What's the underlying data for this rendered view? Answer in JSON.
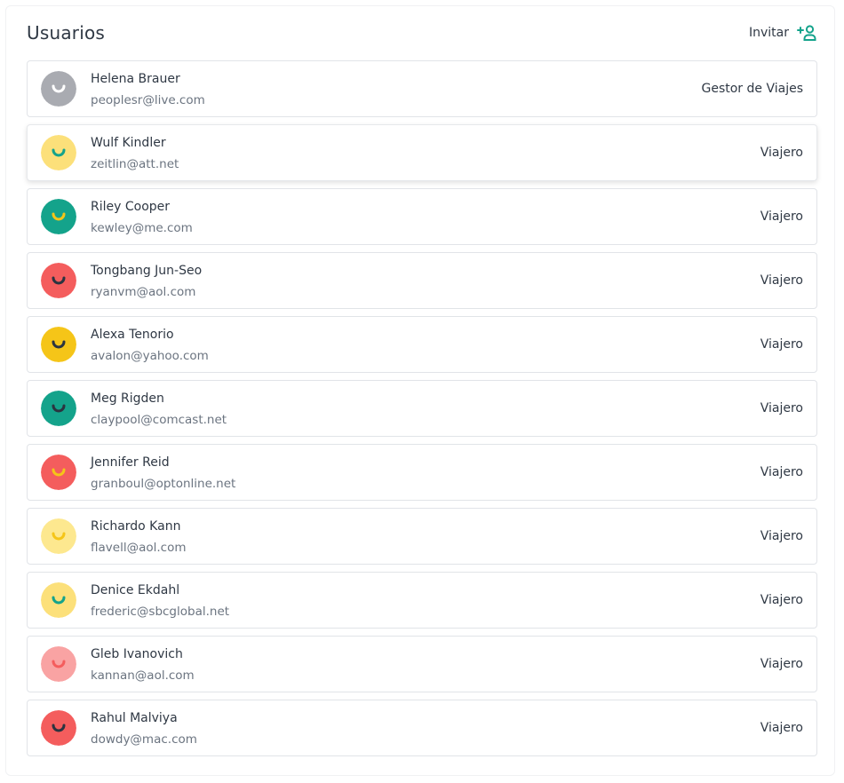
{
  "header": {
    "title": "Usuarios",
    "invite_label": "Invitar",
    "invite_icon": "add-user-icon",
    "invite_color": "#14a38b"
  },
  "users": [
    {
      "name": "Helena Brauer",
      "email": "peoplesr@live.com",
      "role": "Gestor de Viajes",
      "avatar_bg": "#a9abb1",
      "smile_color": "#ffffff"
    },
    {
      "name": "Wulf Kindler",
      "email": "zeitlin@att.net",
      "role": "Viajero",
      "avatar_bg": "#fce07a",
      "smile_color": "#14a38b"
    },
    {
      "name": "Riley Cooper",
      "email": "kewley@me.com",
      "role": "Viajero",
      "avatar_bg": "#14a38b",
      "smile_color": "#f5c518"
    },
    {
      "name": "Tongbang Jun-Seo",
      "email": "ryanvm@aol.com",
      "role": "Viajero",
      "avatar_bg": "#f45d5d",
      "smile_color": "#2b3440"
    },
    {
      "name": "Alexa Tenorio",
      "email": "avalon@yahoo.com",
      "role": "Viajero",
      "avatar_bg": "#f5c518",
      "smile_color": "#2b3440"
    },
    {
      "name": "Meg Rigden",
      "email": "claypool@comcast.net",
      "role": "Viajero",
      "avatar_bg": "#14a38b",
      "smile_color": "#2b3440"
    },
    {
      "name": "Jennifer Reid",
      "email": "granboul@optonline.net",
      "role": "Viajero",
      "avatar_bg": "#f45d5d",
      "smile_color": "#f5c518"
    },
    {
      "name": "Richardo Kann",
      "email": "flavell@aol.com",
      "role": "Viajero",
      "avatar_bg": "#fde88f",
      "smile_color": "#f5c518"
    },
    {
      "name": "Denice Ekdahl",
      "email": "frederic@sbcglobal.net",
      "role": "Viajero",
      "avatar_bg": "#fce07a",
      "smile_color": "#14a38b"
    },
    {
      "name": "Gleb Ivanovich",
      "email": "kannan@aol.com",
      "role": "Viajero",
      "avatar_bg": "#f9a3a3",
      "smile_color": "#f45d5d"
    },
    {
      "name": "Rahul Malviya",
      "email": "dowdy@mac.com",
      "role": "Viajero",
      "avatar_bg": "#f45d5d",
      "smile_color": "#2b3440"
    }
  ]
}
